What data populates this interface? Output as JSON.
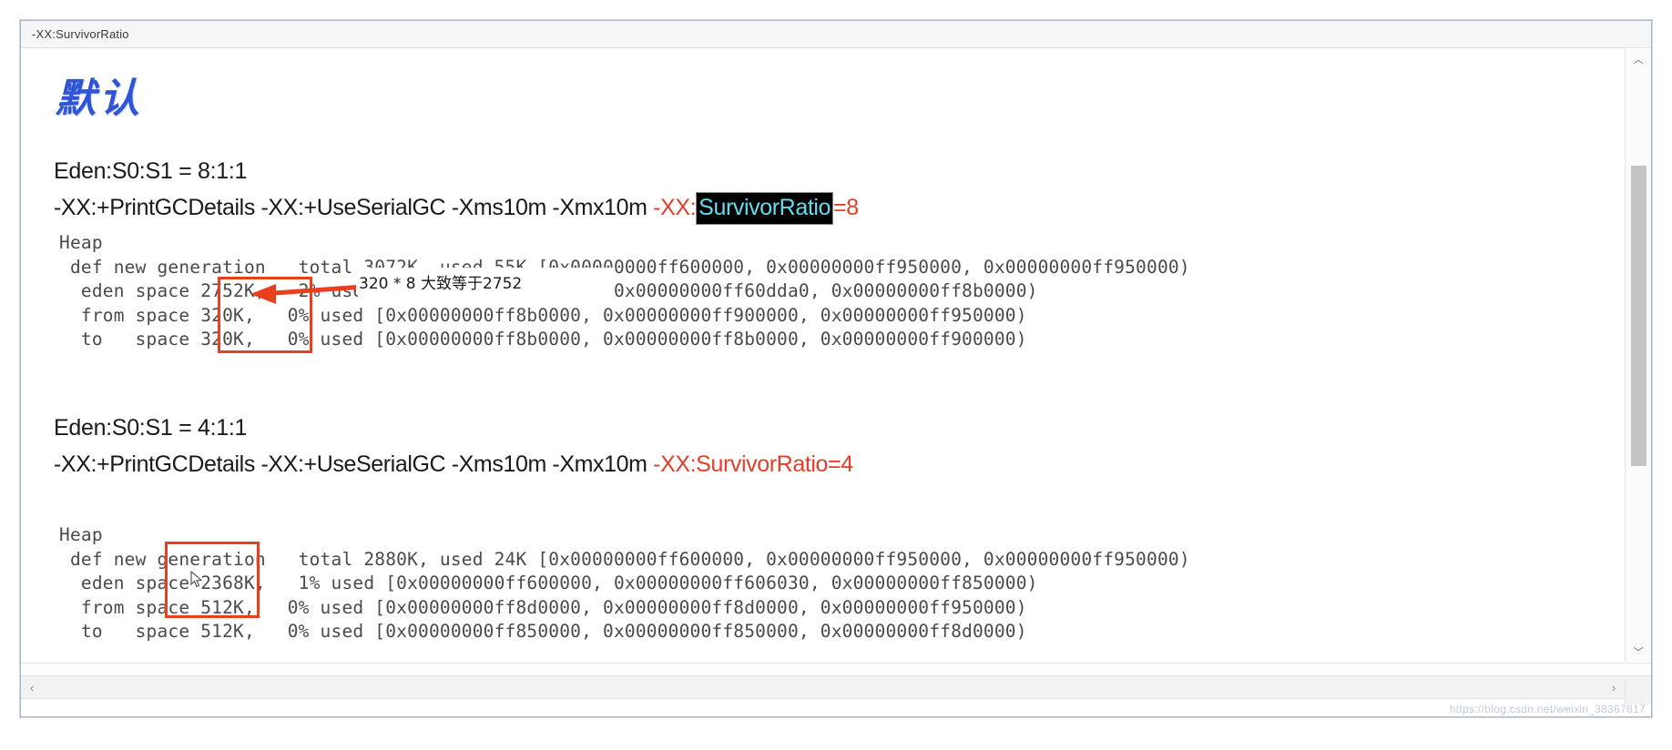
{
  "window": {
    "title": "-XX:SurvivorRatio"
  },
  "document": {
    "cn_heading": "默认",
    "sections": [
      {
        "ratio_label": "Eden:S0:S1 = 8:1:1",
        "command": {
          "plain_prefix": "-XX:+PrintGCDetails -XX:+UseSerialGC -Xms10m -Xmx10m ",
          "red_prefix": "-XX:",
          "highlight": "SurvivorRatio",
          "red_suffix": "=8",
          "highlighted": true
        },
        "heap_lines": [
          "Heap",
          " def new generation   total 3072K, used 55K [0x00000000ff600000, 0x00000000ff950000, 0x00000000ff950000)",
          "  eden space 2752K,   2% used [0x00000000ff600000, 0x00000000ff60dda0, 0x00000000ff8b0000)",
          "  from space 320K,   0% used [0x00000000ff8b0000, 0x00000000ff900000, 0x00000000ff950000)",
          "  to   space 320K,   0% used [0x00000000ff8b0000, 0x00000000ff8b0000, 0x00000000ff900000)"
        ]
      },
      {
        "ratio_label": "Eden:S0:S1 = 4:1:1",
        "command": {
          "plain_prefix": "-XX:+PrintGCDetails -XX:+UseSerialGC -Xms10m -Xmx10m ",
          "red_prefix": "-XX:",
          "highlight": "SurvivorRatio",
          "red_suffix": "=4",
          "highlighted": false
        },
        "heap_lines": [
          "Heap",
          " def new generation   total 2880K, used 24K [0x00000000ff600000, 0x00000000ff950000, 0x00000000ff950000)",
          "  eden space 2368K,   1% used [0x00000000ff600000, 0x00000000ff606030, 0x00000000ff850000)",
          "  from space 512K,   0% used [0x00000000ff8d0000, 0x00000000ff8d0000, 0x00000000ff950000)",
          "  to   space 512K,   0% used [0x00000000ff850000, 0x00000000ff850000, 0x00000000ff8d0000)"
        ]
      }
    ],
    "annotation": {
      "note_text": "320 * 8 大致等于2752",
      "arrow_color": "#e8401f",
      "box_color": "#e8401f"
    }
  },
  "scrollbars": {
    "up_arrow": "︿",
    "down_arrow": "﹀",
    "left_arrow": "‹",
    "right_arrow": "›"
  },
  "watermark": {
    "text": "https://blog.csdn.net/weixin_38367817"
  },
  "colors": {
    "accent_red": "#e2402a",
    "annotation_red": "#e8401f",
    "heading_blue": "#2f55d4",
    "highlight_bg": "#000000",
    "highlight_fg": "#64dcf0",
    "mono_text": "#4a4a4a"
  }
}
